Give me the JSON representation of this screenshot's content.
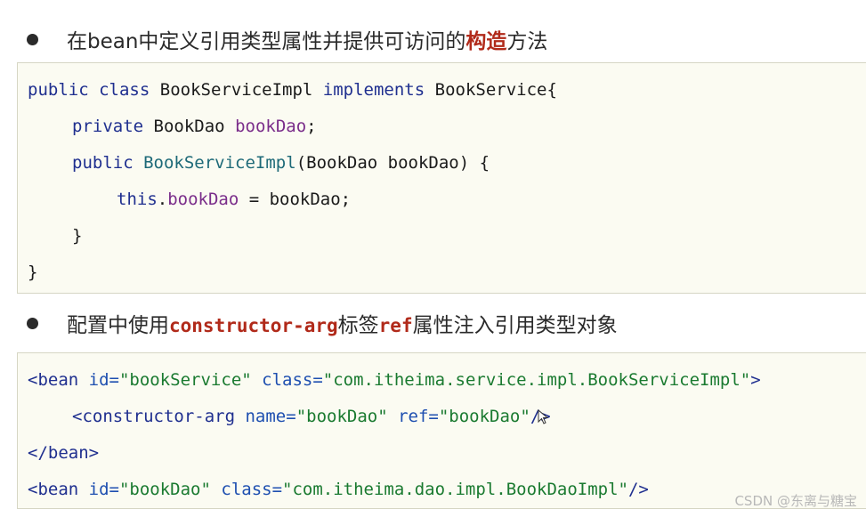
{
  "bullet1": {
    "prefix": "在bean中定义引用类型属性并提供可访问的",
    "highlight": "构造",
    "suffix": "方法"
  },
  "code1": {
    "line1": {
      "kw1": "public",
      "kw2": "class",
      "name": "BookServiceImpl",
      "kw3": "implements",
      "iface": "BookService{"
    },
    "line2": {
      "kw": "private",
      "type": "BookDao",
      "field": "bookDao",
      "end": ";"
    },
    "line3": {
      "kw": "public",
      "ctor": "BookServiceImpl",
      "params": "(BookDao bookDao) {"
    },
    "line4": {
      "kw": "this",
      "dot": ".",
      "field": "bookDao",
      "rest": " = bookDao;"
    },
    "line5": "}",
    "line6": "}"
  },
  "bullet2": {
    "prefix": "配置中使用",
    "highlight1": "constructor-arg",
    "mid": "标签",
    "highlight2": "ref",
    "suffix": "属性注入引用类型对象"
  },
  "code2": {
    "line1": {
      "open": "<bean",
      "a1": "id=",
      "v1": "\"bookService\"",
      "a2": "class=",
      "v2": "\"com.itheima.service.impl.BookServiceImpl\"",
      "close": ">"
    },
    "line2": {
      "open": "<constructor-arg",
      "a1": "name=",
      "v1": "\"bookDao\"",
      "a2": "ref=",
      "v2": "\"bookDao\"",
      "close": "/>"
    },
    "line3": "</bean>",
    "line4": {
      "open": "<bean",
      "a1": "id=",
      "v1": "\"bookDao\"",
      "a2": "class=",
      "v2": "\"com.itheima.dao.impl.BookDaoImpl\"",
      "close": "/>"
    }
  },
  "watermark": "CSDN @东离与糖宝"
}
